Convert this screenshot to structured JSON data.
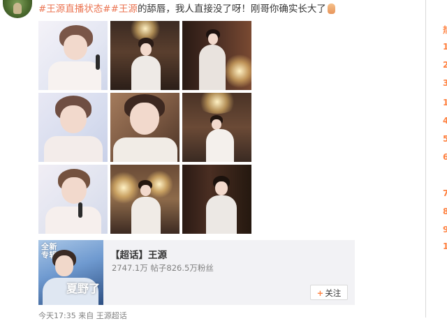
{
  "post": {
    "hashtag1": "#王源直播状态#",
    "hashtag2": "#王源",
    "text": "的舔唇，我人直接没了呀！刚哥你确实长大了"
  },
  "card": {
    "badge_line1": "全新",
    "badge_line2": "专辑",
    "cover_title": "夏野了",
    "title": "【超话】王源",
    "stats": "2747.1万  帖子826.5万粉丝",
    "follow_label": "关注"
  },
  "meta": {
    "time": "今天17:35",
    "from_label": "来自",
    "source": "王源超话"
  },
  "sidebar": {
    "top_char": "热",
    "ranks": [
      "1",
      "1",
      "2",
      "3",
      "1",
      "4",
      "5",
      "6",
      "",
      "7",
      "8",
      "9",
      "1"
    ]
  },
  "colors": {
    "hashtag": "#eb7350",
    "accent": "#ff8140"
  }
}
